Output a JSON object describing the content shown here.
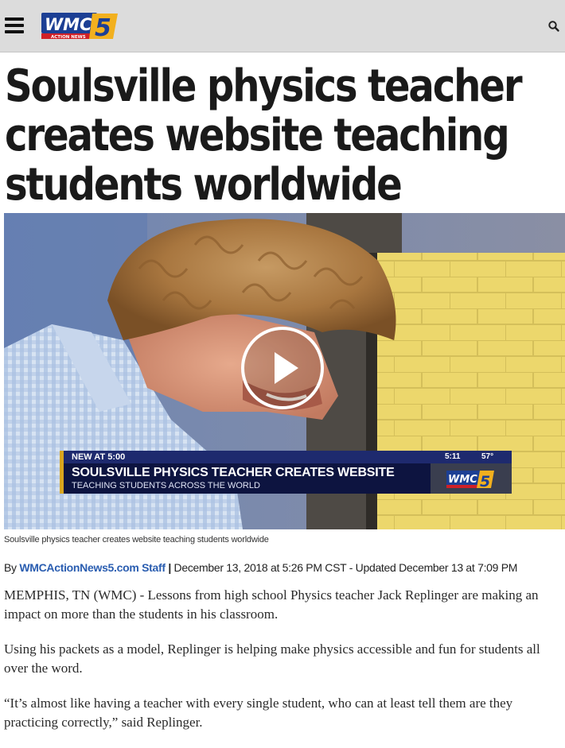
{
  "site": {
    "logo_text": "WMC",
    "logo_subtext": "ACTION NEWS",
    "logo_number": "5"
  },
  "headline": "Soulsville physics teacher creates website teaching students worldwide",
  "video": {
    "lower_third": {
      "label": "NEW AT 5:00",
      "time": "5:11",
      "temperature": "57°",
      "title": "SOULSVILLE PHYSICS TEACHER CREATES WEBSITE",
      "subtitle": "TEACHING STUDENTS ACROSS THE WORLD",
      "logo_text": "WMC",
      "logo_number": "5"
    }
  },
  "caption": "Soulsville physics teacher creates website teaching students worldwide",
  "byline": {
    "prefix": "By",
    "author": "WMCActionNews5.com Staff",
    "separator": "|",
    "dates": "December 13, 2018 at 5:26 PM CST - Updated December 13 at 7:09 PM"
  },
  "article": {
    "paragraphs": [
      "MEMPHIS, TN (WMC) - Lessons from high school Physics teacher Jack Replinger are making an impact on more than the students in his classroom.",
      "Using his packets as a model, Replinger is helping make physics accessible and fun for students all over the word.",
      "“It’s almost like having a teacher with every single student, who can at least tell them are they practicing correctly,” said Replinger."
    ]
  },
  "colors": {
    "header_bg": "#dcdcdc",
    "link": "#2a5db0",
    "logo_blue": "#1c3f94",
    "logo_red": "#d02027",
    "logo_gold": "#f2b01e"
  },
  "icons": {
    "menu": "hamburger-icon",
    "search": "search-icon",
    "play": "play-icon"
  }
}
